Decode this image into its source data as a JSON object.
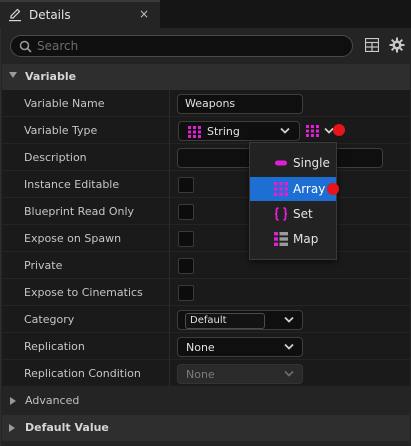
{
  "tab": {
    "title": "Details",
    "close": "×"
  },
  "search": {
    "placeholder": "Search"
  },
  "sections": {
    "variable": "Variable",
    "advanced": "Advanced",
    "default_value": "Default Value"
  },
  "rows": {
    "variable_name": {
      "label": "Variable Name",
      "value": "Weapons"
    },
    "variable_type": {
      "label": "Variable Type",
      "value": "String"
    },
    "description": {
      "label": "Description",
      "value": ""
    },
    "instance_editable": {
      "label": "Instance Editable"
    },
    "blueprint_read_only": {
      "label": "Blueprint Read Only"
    },
    "expose_on_spawn": {
      "label": "Expose on Spawn"
    },
    "private": {
      "label": "Private"
    },
    "expose_to_cinematics": {
      "label": "Expose to Cinematics"
    },
    "category": {
      "label": "Category",
      "value": "Default"
    },
    "replication": {
      "label": "Replication",
      "value": "None"
    },
    "replication_condition": {
      "label": "Replication Condition",
      "value": "None"
    }
  },
  "container_menu": {
    "items": [
      {
        "label": "Single",
        "icon": "single-pill-icon"
      },
      {
        "label": "Array",
        "icon": "array-grid-icon",
        "selected": true
      },
      {
        "label": "Set",
        "icon": "set-braces-icon"
      },
      {
        "label": "Map",
        "icon": "map-icon"
      }
    ]
  },
  "colors": {
    "accent": "#1e6fd4",
    "pin_magenta": "#e01fd6",
    "marker_red": "#e8141a"
  }
}
